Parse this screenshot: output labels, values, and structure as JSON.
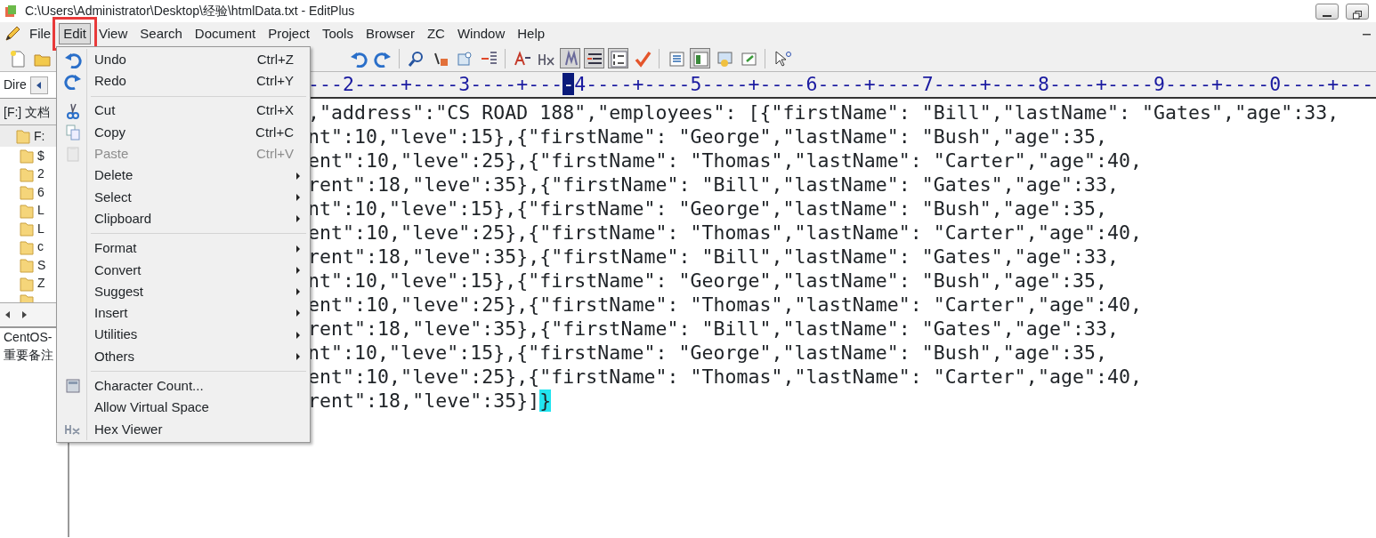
{
  "window": {
    "title": "C:\\Users\\Administrator\\Desktop\\经验\\htmlData.txt - EditPlus"
  },
  "menubar": [
    {
      "label": "File",
      "selected": false,
      "highlighted": false
    },
    {
      "label": "Edit",
      "selected": true,
      "highlighted": true
    },
    {
      "label": "View",
      "selected": false,
      "highlighted": false
    },
    {
      "label": "Search",
      "selected": false,
      "highlighted": false
    },
    {
      "label": "Document",
      "selected": false,
      "highlighted": false
    },
    {
      "label": "Project",
      "selected": false,
      "highlighted": false
    },
    {
      "label": "Tools",
      "selected": false,
      "highlighted": false
    },
    {
      "label": "Browser",
      "selected": false,
      "highlighted": false
    },
    {
      "label": "ZC",
      "selected": false,
      "highlighted": false
    },
    {
      "label": "Window",
      "selected": false,
      "highlighted": false
    },
    {
      "label": "Help",
      "selected": false,
      "highlighted": false
    }
  ],
  "toolbar": {
    "pressed": [
      false,
      false,
      false,
      false,
      false,
      false,
      false,
      false,
      false,
      false,
      true,
      true,
      true,
      false,
      false,
      true,
      false,
      false,
      false
    ]
  },
  "sidebar": {
    "tab": "Dire",
    "drive": "[F:] 文档",
    "tree": [
      {
        "label": "F:",
        "children": [
          {
            "label": "$"
          },
          {
            "label": "2"
          },
          {
            "label": "6"
          },
          {
            "label": "L"
          },
          {
            "label": "L"
          },
          {
            "label": "c"
          },
          {
            "label": "S"
          },
          {
            "label": "Z"
          }
        ]
      }
    ],
    "files": [
      "CentOS-",
      "重要备注"
    ]
  },
  "ruler": {
    "before": "---2----+----3----+---",
    "cursor": "-",
    "after": "4----+----5----+----6----+----7----+----8----+----9----+----0----+---"
  },
  "editor": {
    "lines": [
      {
        "text": ",\"address\":\"CS ROAD 188\",\"employees\": [{\"firstName\": \"Bill\",\"lastName\": \"Gates\",\"age\":33,"
      },
      {
        "text": "nt\":10,\"leve\":15},{\"firstName\": \"George\",\"lastName\": \"Bush\",\"age\":35,"
      },
      {
        "text": "ent\":10,\"leve\":25},{\"firstName\": \"Thomas\",\"lastName\": \"Carter\",\"age\":40,"
      },
      {
        "text": "rent\":18,\"leve\":35},{\"firstName\": \"Bill\",\"lastName\": \"Gates\",\"age\":33,"
      },
      {
        "text": "nt\":10,\"leve\":15},{\"firstName\": \"George\",\"lastName\": \"Bush\",\"age\":35,"
      },
      {
        "text": "ent\":10,\"leve\":25},{\"firstName\": \"Thomas\",\"lastName\": \"Carter\",\"age\":40,"
      },
      {
        "text": "rent\":18,\"leve\":35},{\"firstName\": \"Bill\",\"lastName\": \"Gates\",\"age\":33,"
      },
      {
        "text": "nt\":10,\"leve\":15},{\"firstName\": \"George\",\"lastName\": \"Bush\",\"age\":35,"
      },
      {
        "text": "ent\":10,\"leve\":25},{\"firstName\": \"Thomas\",\"lastName\": \"Carter\",\"age\":40,"
      },
      {
        "text": "rent\":18,\"leve\":35},{\"firstName\": \"Bill\",\"lastName\": \"Gates\",\"age\":33,"
      },
      {
        "text": "nt\":10,\"leve\":15},{\"firstName\": \"George\",\"lastName\": \"Bush\",\"age\":35,"
      },
      {
        "text": "ent\":10,\"leve\":25},{\"firstName\": \"Thomas\",\"lastName\": \"Carter\",\"age\":40,"
      },
      {
        "text": "rent\":18,\"leve\":35}]",
        "bracket": "}"
      }
    ]
  },
  "edit_menu": {
    "items": [
      {
        "kind": "item",
        "label": "Undo",
        "shortcut": "Ctrl+Z",
        "disabled": false,
        "submenu": false
      },
      {
        "kind": "item",
        "label": "Redo",
        "shortcut": "Ctrl+Y",
        "disabled": false,
        "submenu": false
      },
      {
        "kind": "separator"
      },
      {
        "kind": "item",
        "label": "Cut",
        "shortcut": "Ctrl+X",
        "disabled": false,
        "submenu": false
      },
      {
        "kind": "item",
        "label": "Copy",
        "shortcut": "Ctrl+C",
        "disabled": false,
        "submenu": false
      },
      {
        "kind": "item",
        "label": "Paste",
        "shortcut": "Ctrl+V",
        "disabled": true,
        "submenu": false
      },
      {
        "kind": "item",
        "label": "Delete",
        "disabled": false,
        "submenu": true
      },
      {
        "kind": "item",
        "label": "Select",
        "disabled": false,
        "submenu": true
      },
      {
        "kind": "item",
        "label": "Clipboard",
        "disabled": false,
        "submenu": true
      },
      {
        "kind": "separator"
      },
      {
        "kind": "item",
        "label": "Format",
        "disabled": false,
        "submenu": true
      },
      {
        "kind": "item",
        "label": "Convert",
        "disabled": false,
        "submenu": true
      },
      {
        "kind": "item",
        "label": "Suggest",
        "disabled": false,
        "submenu": true
      },
      {
        "kind": "item",
        "label": "Insert",
        "disabled": false,
        "submenu": true
      },
      {
        "kind": "item",
        "label": "Utilities",
        "disabled": false,
        "submenu": true
      },
      {
        "kind": "item",
        "label": "Others",
        "disabled": false,
        "submenu": true
      },
      {
        "kind": "separator"
      },
      {
        "kind": "item",
        "label": "Character Count...",
        "disabled": false,
        "submenu": false
      },
      {
        "kind": "item",
        "label": "Allow Virtual Space",
        "disabled": false,
        "submenu": false
      },
      {
        "kind": "item",
        "label": "Hex Viewer",
        "disabled": false,
        "submenu": false
      }
    ]
  }
}
